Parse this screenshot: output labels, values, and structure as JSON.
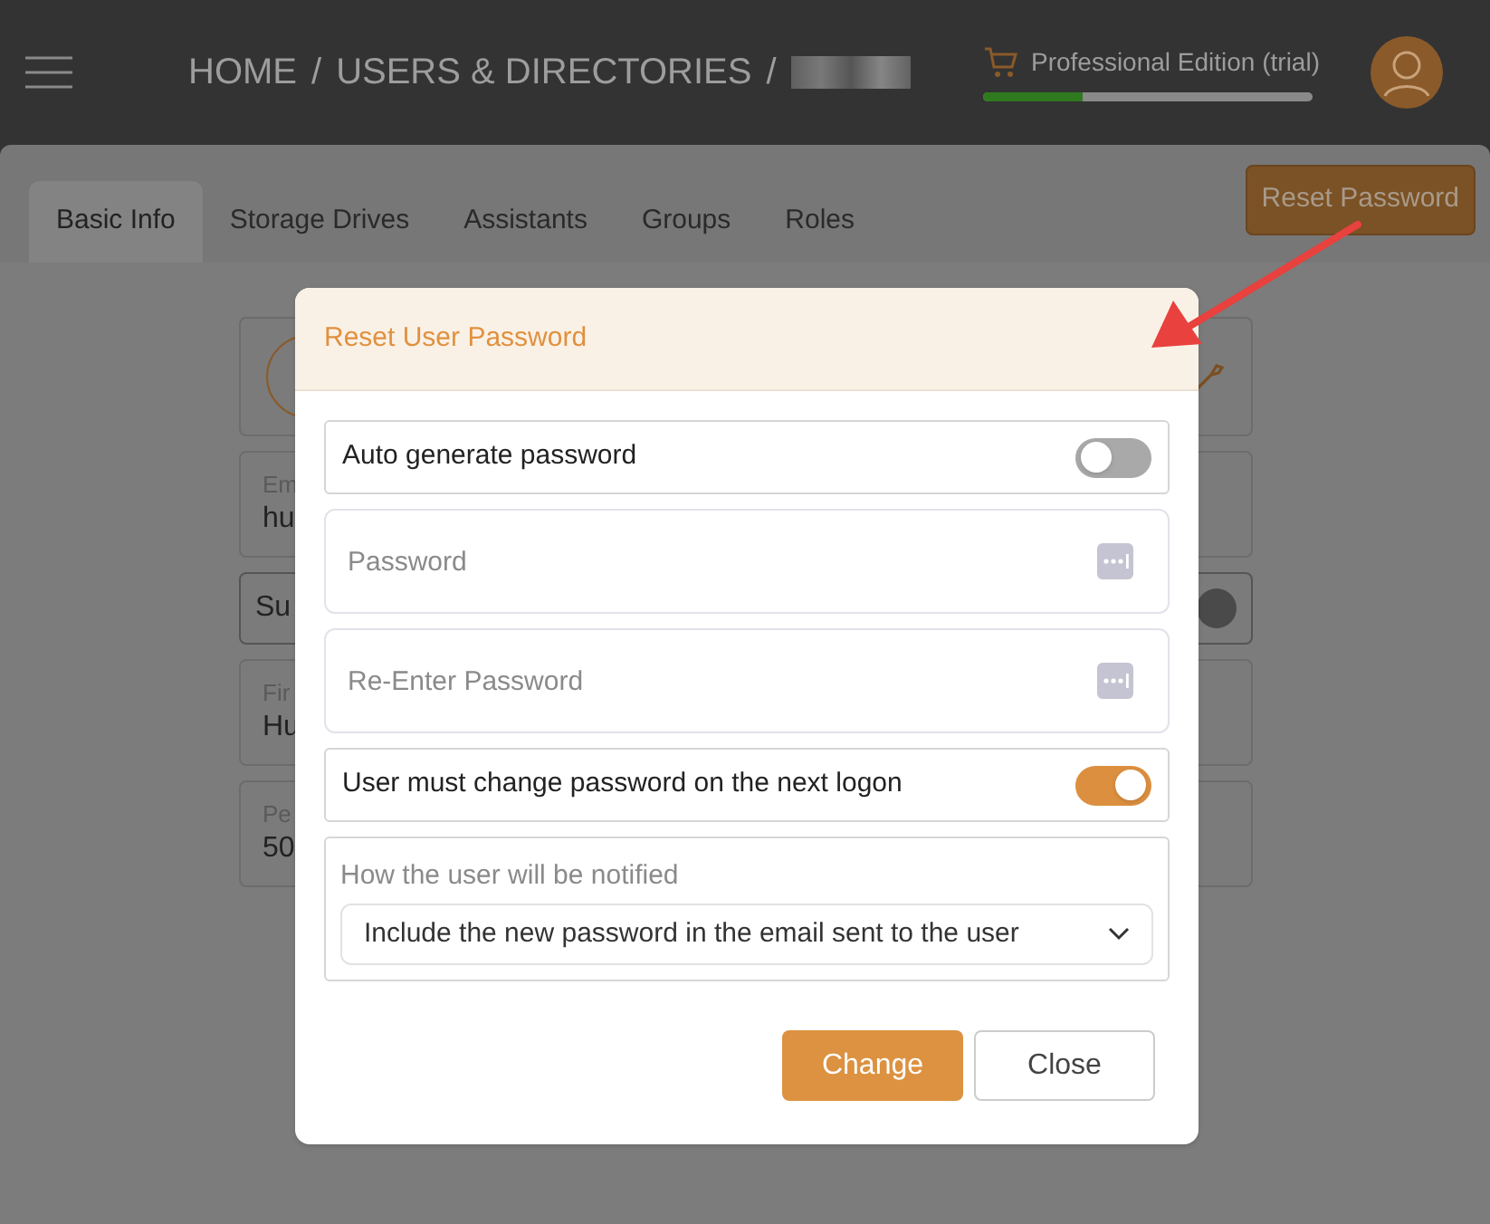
{
  "header": {
    "breadcrumb": [
      "HOME",
      "/",
      "USERS & DIRECTORIES",
      "/"
    ],
    "edition": "Professional Edition (trial)",
    "trial": {
      "level": 0.3
    }
  },
  "tabs": [
    {
      "label": "Basic Info",
      "selected": true
    },
    {
      "label": "Storage Drives",
      "selected": false
    },
    {
      "label": "Assistants",
      "selected": false
    },
    {
      "label": "Groups",
      "selected": false
    },
    {
      "label": "Roles",
      "selected": false
    }
  ],
  "reset_button": "Reset Password",
  "background_cards": [
    {
      "kind": "avatar"
    },
    {
      "kind": "field",
      "label": "Em",
      "value": "hu"
    },
    {
      "kind": "toggle",
      "label": "Su"
    },
    {
      "kind": "field",
      "label": "Fir",
      "value": "Hu"
    },
    {
      "kind": "field",
      "label": "Pe",
      "value": "50"
    }
  ],
  "dialog": {
    "title": "Reset User Password",
    "rows": [
      {
        "kind": "switch",
        "label": "Auto generate password",
        "on": false
      },
      {
        "kind": "password",
        "placeholder": "Password"
      },
      {
        "kind": "password",
        "placeholder": "Re-Enter Password"
      },
      {
        "kind": "switch",
        "label": "User must change password on the next logon",
        "on": true
      },
      {
        "kind": "select",
        "label": "How the user will be notified",
        "value": "Include the new password in the email sent to the user"
      }
    ],
    "buttons": [
      {
        "label": "Change",
        "kind": "primary"
      },
      {
        "label": "Close",
        "kind": "secondary"
      }
    ]
  }
}
